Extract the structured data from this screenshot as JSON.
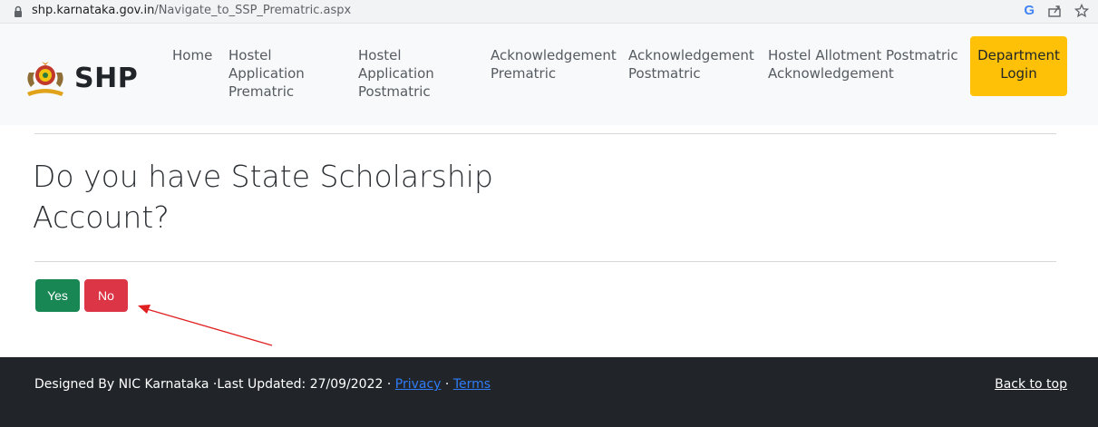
{
  "browser": {
    "url_host": "shp.karnataka.gov.in",
    "url_path": "/Navigate_to_SSP_Prematric.aspx",
    "icons": [
      "lock-icon",
      "google-icon",
      "share-icon",
      "star-icon"
    ],
    "google_letter": "G"
  },
  "navbar": {
    "brand": "SHP",
    "links": [
      "Home",
      "Hostel Application Prematric",
      "Hostel Application Postmatric",
      "Acknowledgement Prematric",
      "Acknowledgement Postmatric",
      "Hostel Allotment Postmatric Acknowledgement"
    ],
    "department_login": "Department Login"
  },
  "main": {
    "question": "Do you have State Scholarship Account?",
    "yes_label": "Yes",
    "no_label": "No"
  },
  "footer": {
    "designed_by": "Designed By NIC Karnataka ·Last Updated: 27/09/2022 · ",
    "privacy": "Privacy",
    "separator": " · ",
    "terms": "Terms",
    "back_to_top": "Back to top"
  },
  "colors": {
    "yes": "#198754",
    "no": "#dc3545",
    "department": "#ffc107",
    "footer": "#212529",
    "annotation_arrow": "#e02020"
  }
}
